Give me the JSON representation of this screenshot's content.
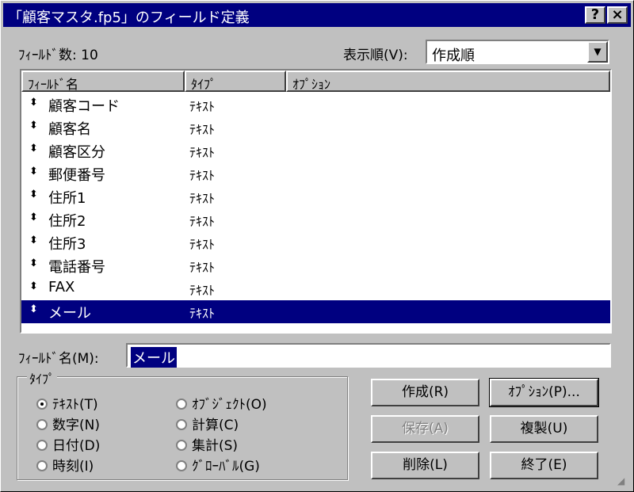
{
  "window": {
    "title": "「顧客マスタ.fp5」のフィールド定義",
    "help_label": "?",
    "close_label": "×"
  },
  "field_count_label": "ﾌｨｰﾙﾄﾞ数: 10",
  "sort": {
    "label": "表示順(V):",
    "value": "作成順"
  },
  "columns": [
    "ﾌｨｰﾙﾄﾞ名",
    "ﾀｲﾌﾟ",
    "ｵﾌﾟｼｮﾝ"
  ],
  "fields": [
    {
      "name": "顧客コード",
      "type": "ﾃｷｽﾄ",
      "option": ""
    },
    {
      "name": "顧客名",
      "type": "ﾃｷｽﾄ",
      "option": ""
    },
    {
      "name": "顧客区分",
      "type": "ﾃｷｽﾄ",
      "option": ""
    },
    {
      "name": "郵便番号",
      "type": "ﾃｷｽﾄ",
      "option": ""
    },
    {
      "name": "住所1",
      "type": "ﾃｷｽﾄ",
      "option": ""
    },
    {
      "name": "住所2",
      "type": "ﾃｷｽﾄ",
      "option": ""
    },
    {
      "name": "住所3",
      "type": "ﾃｷｽﾄ",
      "option": ""
    },
    {
      "name": "電話番号",
      "type": "ﾃｷｽﾄ",
      "option": ""
    },
    {
      "name": "FAX",
      "type": "ﾃｷｽﾄ",
      "option": ""
    },
    {
      "name": "メール",
      "type": "ﾃｷｽﾄ",
      "option": ""
    }
  ],
  "selected_index": 9,
  "field_name": {
    "label": "ﾌｨｰﾙﾄﾞ名(M):",
    "value": "メール"
  },
  "type_group": {
    "legend": "ﾀｲﾌﾟ",
    "options": [
      "ﾃｷｽﾄ(T)",
      "数字(N)",
      "日付(D)",
      "時刻(I)",
      "ｵﾌﾞｼﾞｪｸﾄ(O)",
      "計算(C)",
      "集計(S)",
      "ｸﾞﾛｰﾊﾞﾙ(G)"
    ],
    "selected": "ﾃｷｽﾄ(T)"
  },
  "buttons": {
    "create": "作成(R)",
    "options": "ｵﾌﾟｼｮﾝ(P)...",
    "save": "保存(A)",
    "duplicate": "複製(U)",
    "delete": "削除(L)",
    "exit": "終了(E)"
  }
}
